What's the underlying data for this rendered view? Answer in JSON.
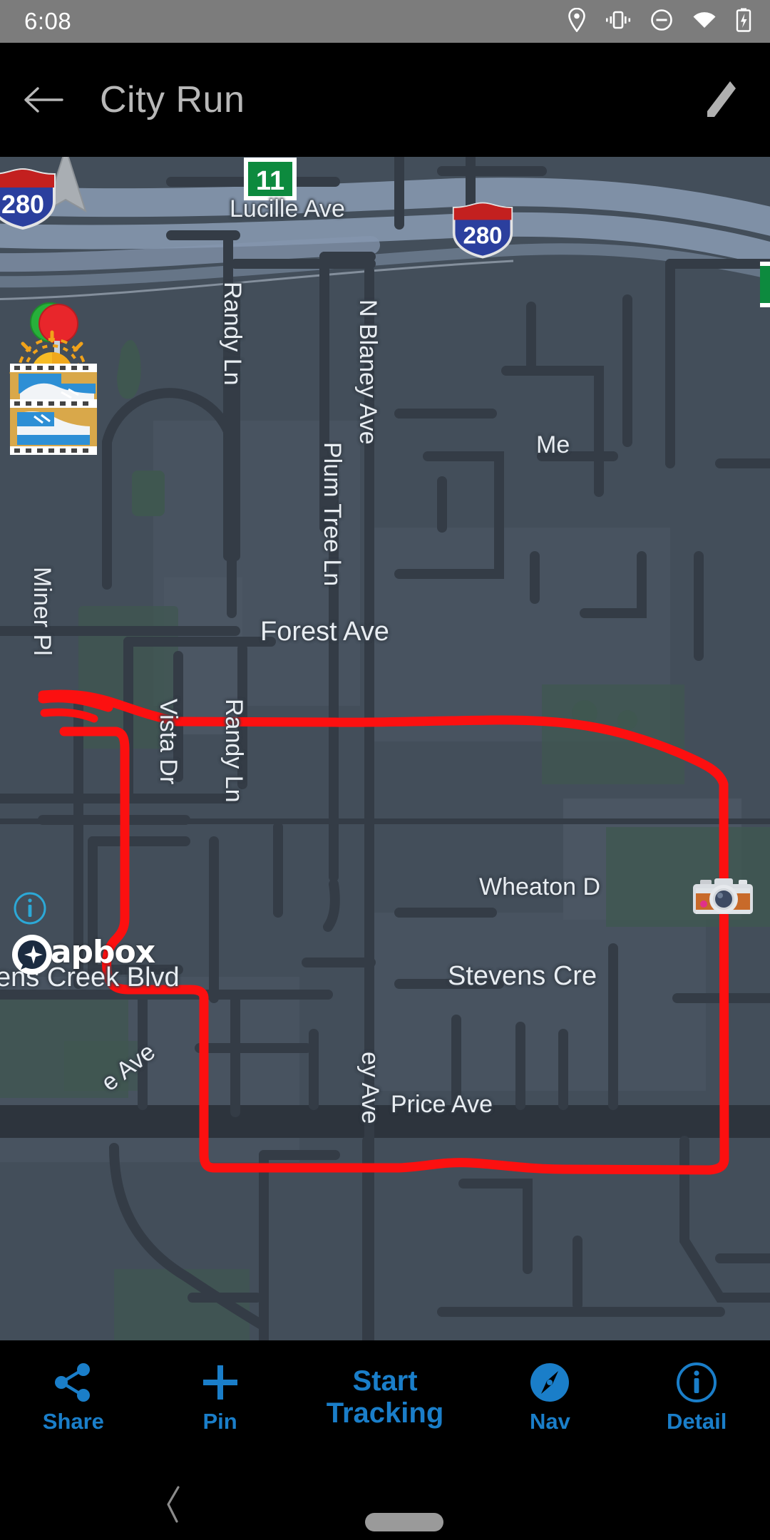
{
  "status_bar": {
    "time": "6:08",
    "icons": [
      "location-pin-icon",
      "vibrate-icon",
      "do-not-disturb-icon",
      "wifi-icon",
      "battery-charging-icon"
    ]
  },
  "app_bar": {
    "back_label": "back-arrow-icon",
    "title": "City Run",
    "edit_label": "edit-pencil-icon"
  },
  "map": {
    "provider": "mapbox",
    "attribution_word": "mapbox",
    "info_label": "i",
    "background_color": "#434e5a",
    "route_color": "#fc1010",
    "road_color": "#343c46",
    "motorway_color": "#8496ad",
    "park_color": "#3f5750",
    "labels": [
      {
        "name": "lucille-ave",
        "text": "Lucille Ave"
      },
      {
        "name": "randy-ln-north",
        "text": "Randy Ln"
      },
      {
        "name": "n-blaney-ave",
        "text": "N Blaney Ave"
      },
      {
        "name": "plum-tree-ln",
        "text": "Plum Tree Ln"
      },
      {
        "name": "miner-pl",
        "text": "Miner Pl"
      },
      {
        "name": "forest-ave",
        "text": "Forest Ave"
      },
      {
        "name": "vista-dr",
        "text": "Vista Dr"
      },
      {
        "name": "randy-ln-south",
        "text": "Randy Ln"
      },
      {
        "name": "wheaton-dr",
        "text": "Wheaton D"
      },
      {
        "name": "stevens-creek-blvd-left",
        "text": "ens Creek Blvd"
      },
      {
        "name": "stevens-creek-blvd-right",
        "text": "Stevens Cre"
      },
      {
        "name": "merriman-ave",
        "text": "Me"
      },
      {
        "name": "blaney-ave-south",
        "text": "ey Ave"
      },
      {
        "name": "price-ave",
        "text": "Price Ave"
      },
      {
        "name": "creek-ave-diagonal",
        "text": "e Ave"
      }
    ],
    "shields": [
      {
        "name": "interstate-280-left",
        "text": "280",
        "type": "interstate"
      },
      {
        "name": "interstate-280-right",
        "text": "280",
        "type": "interstate"
      },
      {
        "name": "route-11",
        "text": "11",
        "type": "state"
      }
    ],
    "markers": [
      {
        "name": "start-pin-marker",
        "emoji": "pin-green-red"
      },
      {
        "name": "waypoint-sun-marker",
        "emoji": "sun-yellow"
      },
      {
        "name": "shoe-marker-upper",
        "emoji": "running-shoe"
      },
      {
        "name": "shoe-marker-lower",
        "emoji": "running-shoe"
      },
      {
        "name": "camera-marker",
        "emoji": "camera"
      }
    ],
    "compass": "north-arrow-icon"
  },
  "tab_bar": {
    "accent_color": "#1a7ec9",
    "items": [
      {
        "name": "share",
        "label": "Share",
        "icon": "share-icon"
      },
      {
        "name": "pin",
        "label": "Pin",
        "icon": "plus-icon"
      },
      {
        "name": "nav",
        "label": "Nav",
        "icon": "compass-icon"
      },
      {
        "name": "detail",
        "label": "Detail",
        "icon": "info-icon"
      }
    ],
    "center_action": {
      "name": "start-tracking",
      "line1": "Start",
      "line2": "Tracking"
    }
  },
  "gesture_bar": {
    "back": "gesture-back-icon",
    "home": "gesture-home-pill"
  }
}
